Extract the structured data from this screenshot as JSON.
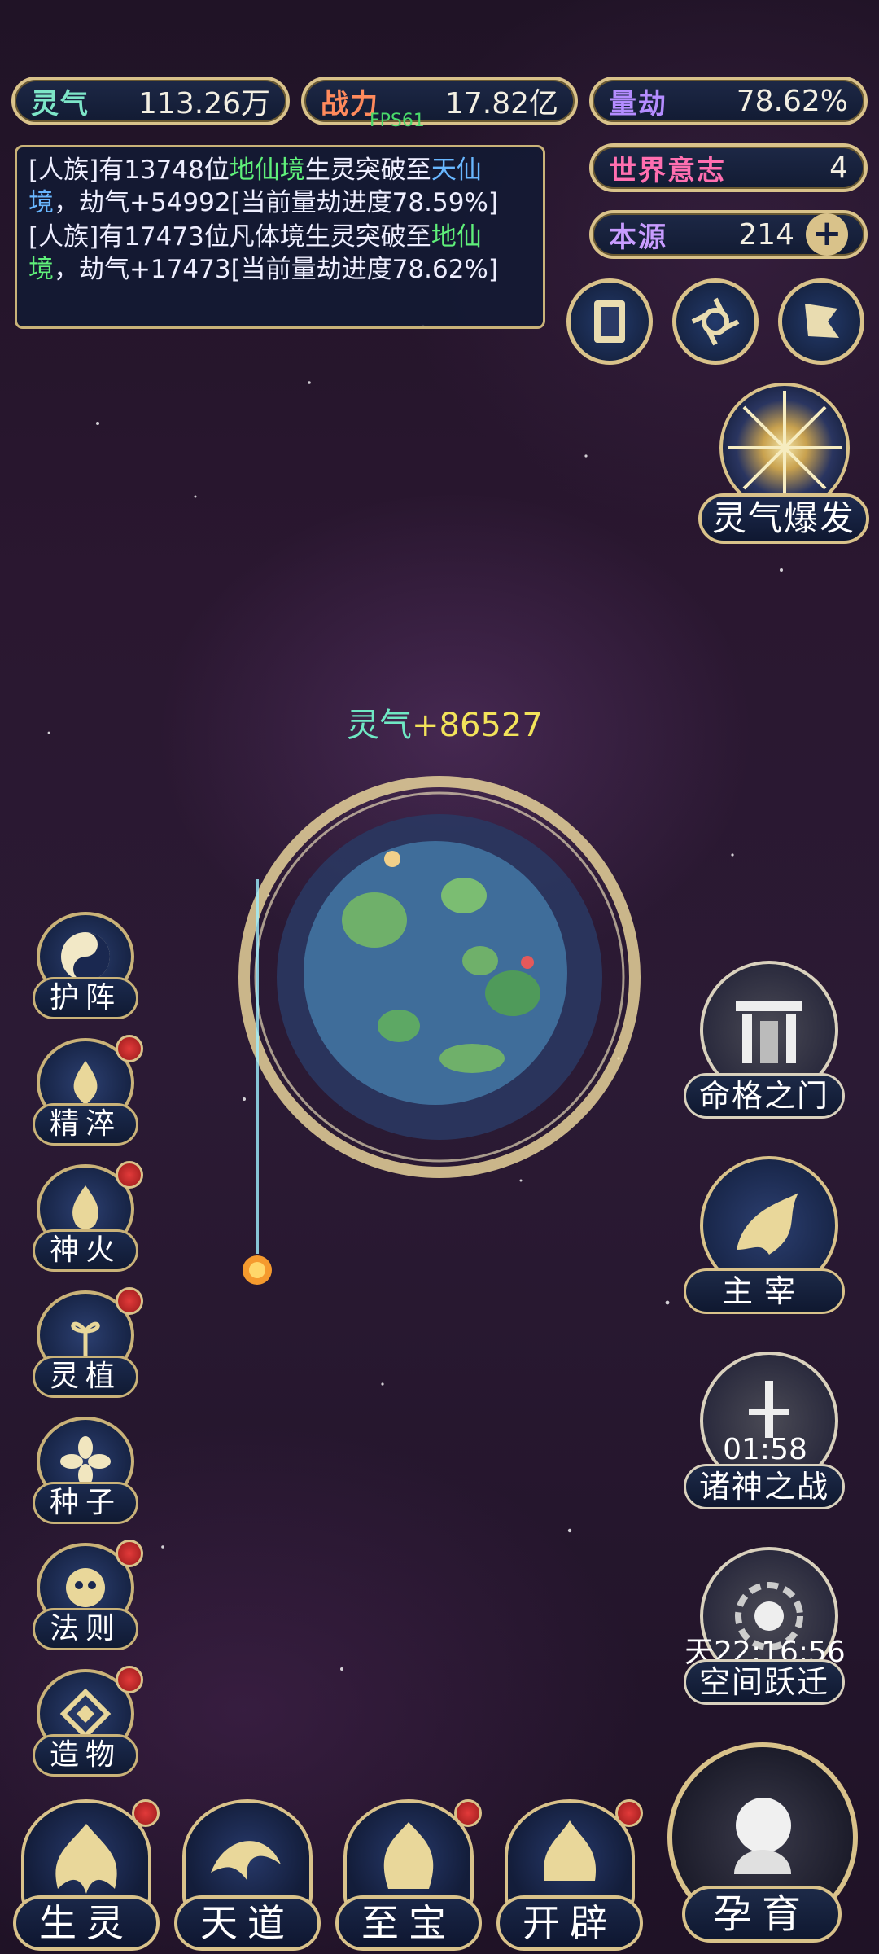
{
  "top_stats": {
    "lingqi": {
      "label": "灵气",
      "value": "113.26万"
    },
    "zhanli": {
      "label": "战力",
      "value": "17.82亿"
    },
    "liangjie": {
      "label": "量劫",
      "value": "78.62%"
    },
    "shijie": {
      "label": "世界意志",
      "value": "4"
    },
    "benyuan": {
      "label": "本源",
      "value": "214"
    }
  },
  "fps_text": "FPS61",
  "log_messages": [
    {
      "prefix": "[人族]有13748位",
      "realm": "地仙境",
      "mid": "生灵突破至",
      "target": "天仙境",
      "suffix": "，劫气+54992[当前量劫进度78.59%]"
    },
    {
      "prefix": "[人族]有17473位凡体境生灵突破至",
      "realm": "地仙境",
      "mid": "",
      "target": "",
      "suffix": "，劫气+17473[当前量劫进度78.62%]"
    }
  ],
  "lingqi_burst": {
    "label": "灵气爆发"
  },
  "float_gain": {
    "label": "灵气",
    "value": "+86527"
  },
  "left_menu": [
    {
      "label": "护阵",
      "icon": "yinyang-icon",
      "dot": false
    },
    {
      "label": "精淬",
      "icon": "lotus-flame-icon",
      "dot": true
    },
    {
      "label": "神火",
      "icon": "divine-fire-icon",
      "dot": true
    },
    {
      "label": "灵植",
      "icon": "spirit-plant-icon",
      "dot": true
    },
    {
      "label": "种子",
      "icon": "seed-icon",
      "dot": false
    },
    {
      "label": "法则",
      "icon": "law-mask-icon",
      "dot": true
    },
    {
      "label": "造物",
      "icon": "creation-icon",
      "dot": true
    }
  ],
  "right_menu": {
    "mingge": {
      "label": "命格之门"
    },
    "zhuzai": {
      "label": "主宰"
    },
    "zhushen": {
      "label": "诸神之战",
      "timer": "01:58"
    },
    "kongjian": {
      "label": "空间跃迁",
      "timer": "天22:16:56"
    }
  },
  "bottom_menu": [
    {
      "label": "生灵",
      "dot": true
    },
    {
      "label": "天道",
      "dot": false
    },
    {
      "label": "至宝",
      "dot": true
    },
    {
      "label": "开辟",
      "dot": true
    }
  ],
  "yunyu": {
    "label": "孕育"
  },
  "colors": {
    "gold": "#d9c28a",
    "green": "#5ff07a",
    "blue": "#69b7ff",
    "red": "#e23a3a"
  }
}
